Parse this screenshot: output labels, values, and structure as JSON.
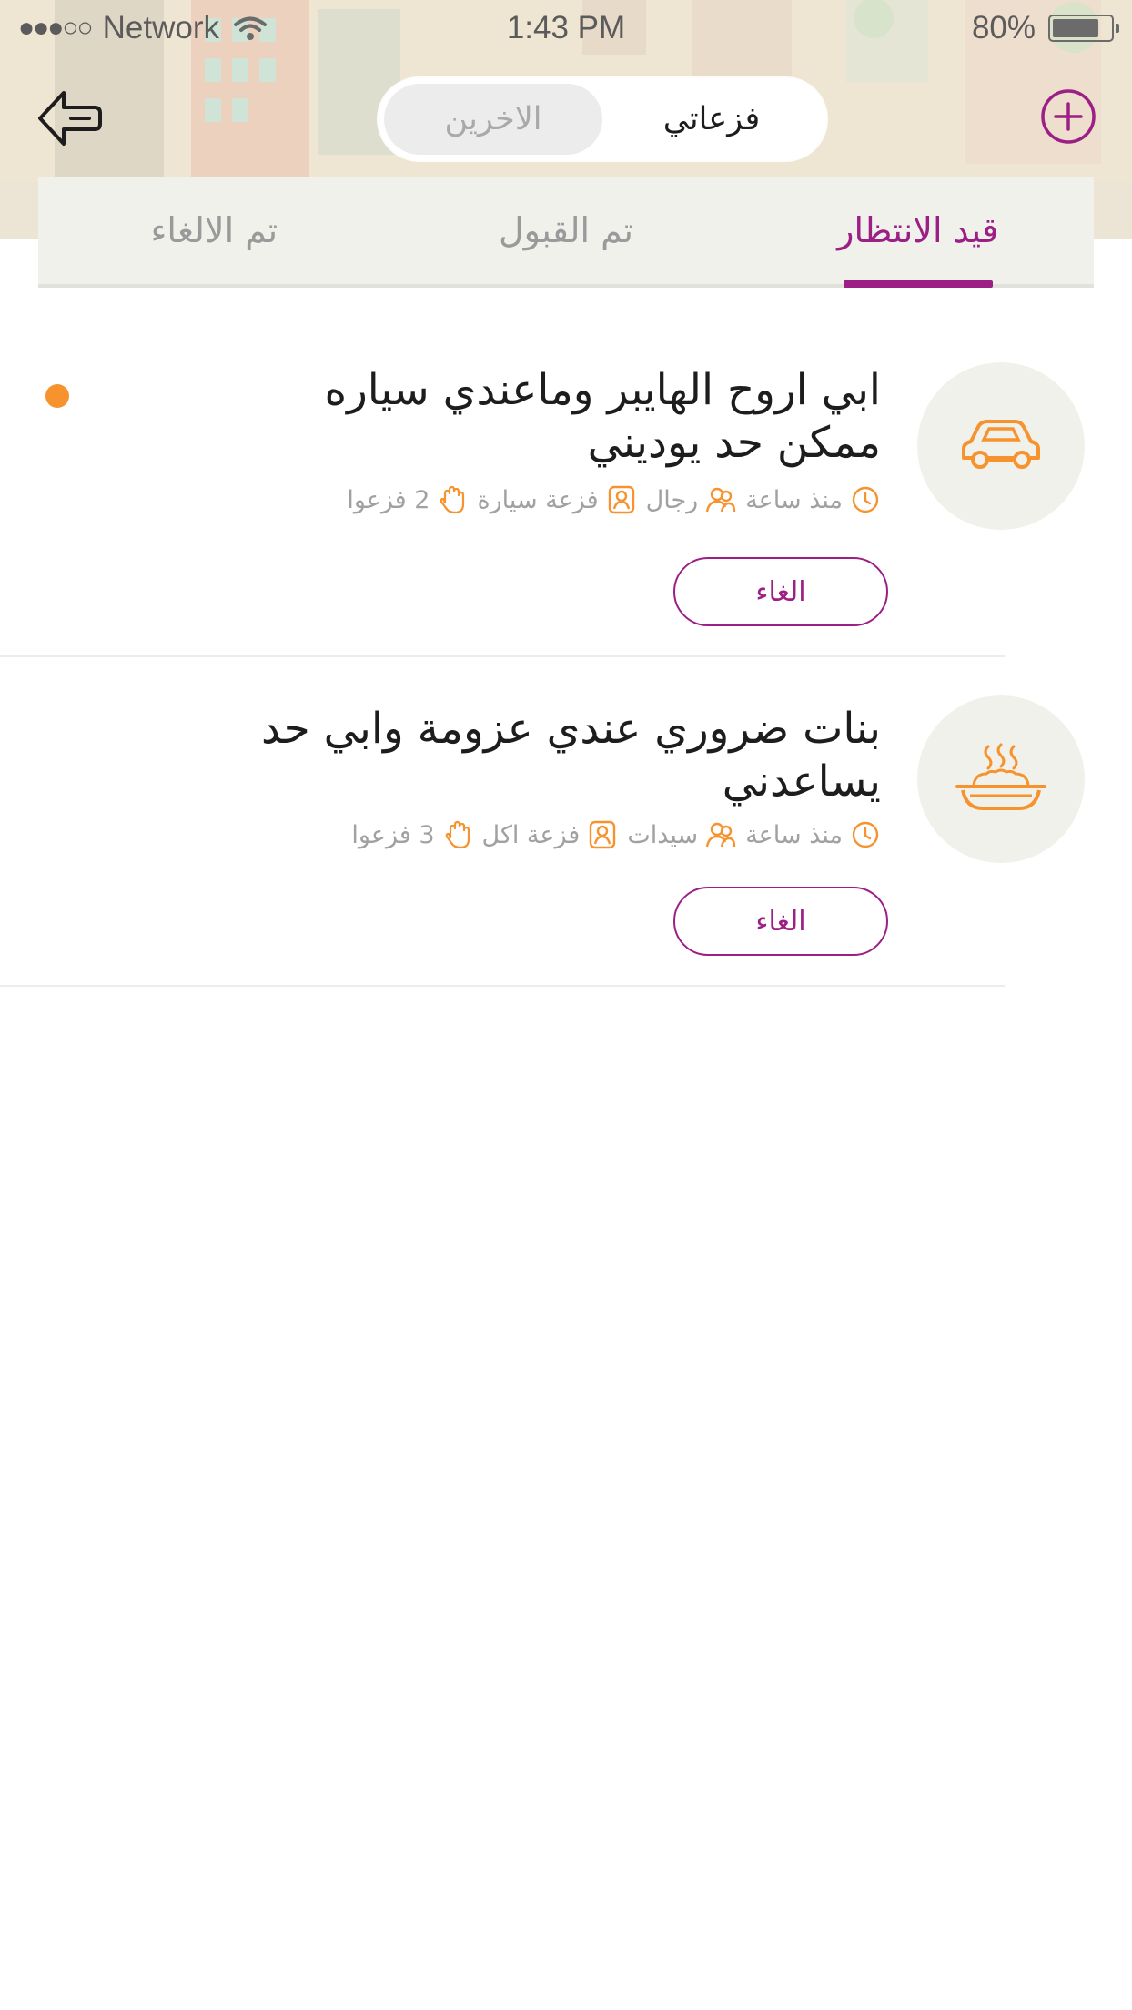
{
  "colors": {
    "accent": "#9c1f86",
    "orange": "#f7932e",
    "muted_text": "#a1a1a1",
    "tab_bg": "#f1f1ec"
  },
  "status_bar": {
    "signal": "●●●○○",
    "carrier": "Network",
    "time": "1:43 PM",
    "battery_percent": "80%",
    "battery_level": 0.8
  },
  "header": {
    "back_icon": "back-arrow-icon",
    "add_icon": "plus-circle-icon",
    "segments": [
      {
        "label": "فزعاتي",
        "active": true
      },
      {
        "label": "الاخرين",
        "active": false
      }
    ]
  },
  "tabs": [
    {
      "label": "قيد الانتظار",
      "active": true
    },
    {
      "label": "تم القبول",
      "active": false
    },
    {
      "label": "تم الالغاء",
      "active": false
    }
  ],
  "requests": [
    {
      "category_icon": "car-icon",
      "title": "ابي اروح الهايبر وماعندي سياره ممكن حد يوديني",
      "time": "منذ ساعة",
      "audience": "رجال",
      "category": "فزعة سيارة",
      "responders": "2 فزعوا",
      "unread": true,
      "action_label": "الغاء"
    },
    {
      "category_icon": "food-dish-icon",
      "title": "بنات ضروري عندي عزومة وابي حد يساعدني",
      "time": "منذ ساعة",
      "audience": "سيدات",
      "category": "فزعة اكل",
      "responders": "3 فزعوا",
      "unread": false,
      "action_label": "الغاء"
    }
  ]
}
